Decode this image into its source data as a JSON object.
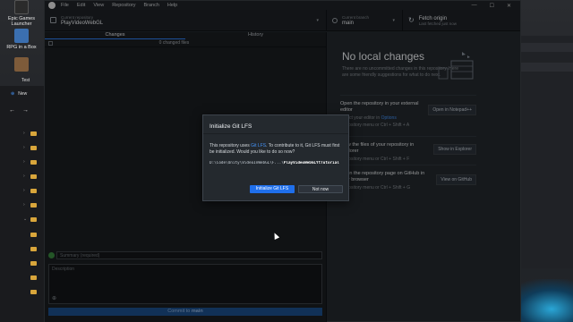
{
  "desktop": {
    "icons": [
      {
        "label": "Epic Games Launcher",
        "color": "#2b2b2b"
      },
      {
        "label": "RPG in a Box",
        "color": "#3b6fb0"
      },
      {
        "label": "",
        "color": "#7d5b3a"
      }
    ],
    "explorer": {
      "tab": "Test",
      "new_label": "New"
    }
  },
  "app": {
    "menu": [
      "File",
      "Edit",
      "View",
      "Repository",
      "Branch",
      "Help"
    ],
    "window_controls": [
      "—",
      "☐",
      "✕"
    ]
  },
  "toolbar": {
    "repo_label": "Current repository",
    "repo_value": "PlayVideoWebGL",
    "branch_label": "Current branch",
    "branch_value": "main",
    "fetch_label": "Fetch origin",
    "fetch_sub": "Last fetched just now"
  },
  "left": {
    "tabs": [
      "Changes",
      "History"
    ],
    "changed_files": "0 changed files",
    "summary_placeholder": "Summary (required)",
    "description_placeholder": "Description",
    "commit_label_prefix": "Commit to ",
    "commit_branch": "main"
  },
  "right": {
    "title": "No local changes",
    "subtitle": "There are no uncommitted changes in this repository. Here are some friendly suggestions for what to do next.",
    "suggestions": [
      {
        "title": "Open the repository in your external editor",
        "sub_prefix": "Select your editor in ",
        "sub_link": "Options",
        "shortcut": "Repository menu or  Ctrl + Shift + A",
        "button": "Open in Notepad++"
      },
      {
        "title": "View the files of your repository in Explorer",
        "shortcut": "Repository menu or  Ctrl + Shift + F",
        "button": "Show in Explorer"
      },
      {
        "title": "Open the repository page on GitHub in your browser",
        "shortcut": "Repository menu or  Ctrl + Shift + G",
        "button": "View on GitHub"
      }
    ]
  },
  "dialog": {
    "title": "Initialize Git LFS",
    "body_before": "This repository uses ",
    "body_link": "Git LFS",
    "body_after": ". To contribute to it, Git LFS must first be initialized. Would you like to do so now?",
    "path_prefix": "D:\\Code\\Unity\\VideoInWebGL\\F...\\",
    "path_bold": "PlayVideoWebGLYtTutorial",
    "primary_button": "Initialize Git LFS",
    "secondary_button": "Not now"
  }
}
